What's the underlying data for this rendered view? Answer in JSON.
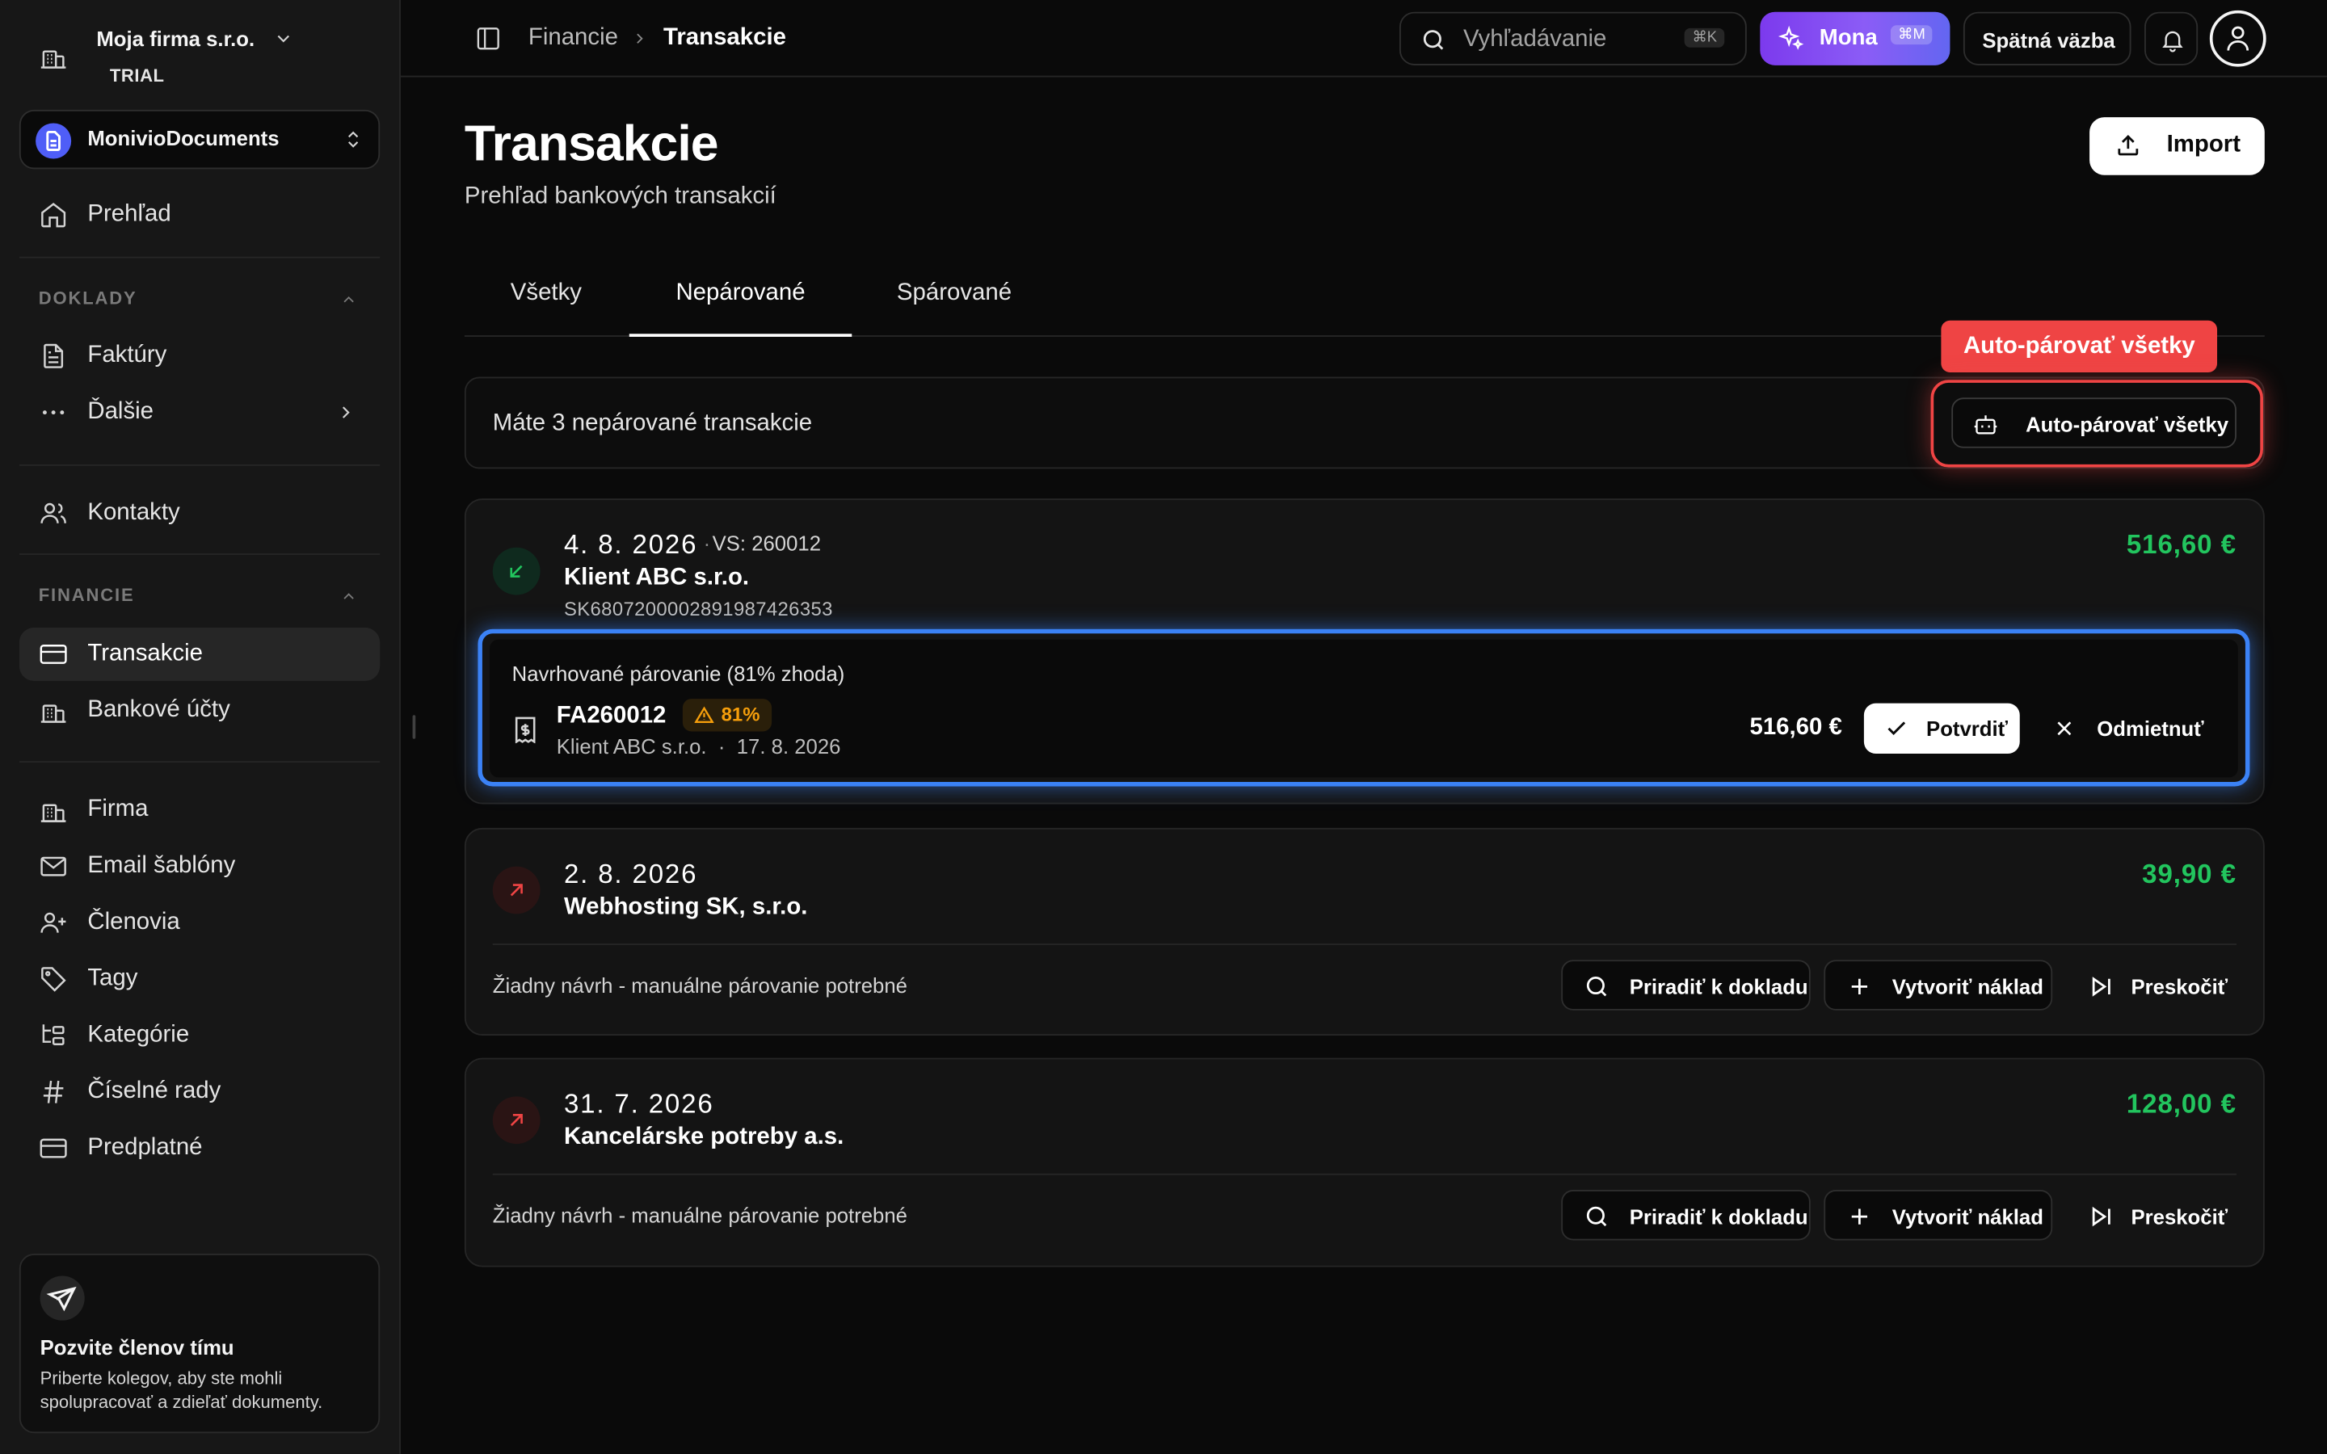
{
  "org": {
    "name": "Moja firma s.r.o.",
    "plan": "TRIAL"
  },
  "workspace": {
    "name": "MonivioDocuments"
  },
  "sidebar": {
    "overview": "Prehľad",
    "section_documents": "DOKLADY",
    "invoices": "Faktúry",
    "more": "Ďalšie",
    "contacts": "Kontakty",
    "section_finance": "FINANCIE",
    "transactions": "Transakcie",
    "bank_accounts": "Bankové účty",
    "company": "Firma",
    "email_templates": "Email šablóny",
    "members": "Členovia",
    "tags": "Tagy",
    "categories": "Kategórie",
    "number_series": "Číselné rady",
    "subscription": "Predplatné",
    "invite": {
      "title": "Pozvite členov tímu",
      "text": "Priberte kolegov, aby ste mohli spolupracovať a zdieľať dokumenty."
    }
  },
  "topbar": {
    "crumb_parent": "Financie",
    "crumb_current": "Transakcie",
    "search_placeholder": "Vyhľadávanie",
    "search_kbd": "⌘K",
    "mona_label": "Mona",
    "mona_kbd": "⌘M",
    "feedback_label": "Spätná väzba"
  },
  "page": {
    "title": "Transakcie",
    "subtitle": "Prehľad bankových transakcií",
    "import_label": "Import"
  },
  "tabs": [
    "Všetky",
    "Nepárované",
    "Spárované"
  ],
  "info": {
    "text": "Máte 3 nepárované transakcie",
    "auto_label": "Auto-párovať všetky",
    "tooltip": "Auto-párovať všetky"
  },
  "transactions": [
    {
      "date": "4. 8. 2026",
      "vs": "VS: 260012",
      "party": "Klient ABC s.r.o.",
      "iban": "SK6807200002891987426353",
      "amount": "516,60 €",
      "direction": "in"
    },
    {
      "date": "2. 8. 2026",
      "party": "Webhosting SK, s.r.o.",
      "amount": "39,90 €",
      "direction": "out",
      "no_match": "Žiadny návrh - manuálne párovanie potrebné"
    },
    {
      "date": "31. 7. 2026",
      "party": "Kancelárske potreby a.s.",
      "amount": "128,00 €",
      "direction": "out",
      "no_match": "Žiadny návrh - manuálne párovanie potrebné"
    }
  ],
  "suggestion": {
    "title": "Navrhované párovanie (81% zhoda)",
    "doc_number": "FA260012",
    "match": "81%",
    "meta_party": "Klient ABC s.r.o.",
    "meta_dot": "·",
    "meta_date": "17. 8. 2026",
    "amount": "516,60 €",
    "confirm_label": "Potvrdiť",
    "reject_label": "Odmietnuť"
  },
  "actions": {
    "assign": "Priradiť k dokladu",
    "create_expense": "Vytvoriť náklad",
    "skip": "Preskočiť"
  },
  "colors": {
    "accent_positive": "#22c55e",
    "highlight_red": "#ef4444",
    "highlight_blue": "#3b82f6",
    "mona_gradient": "#7c3aed",
    "warning": "#f59e0b"
  }
}
